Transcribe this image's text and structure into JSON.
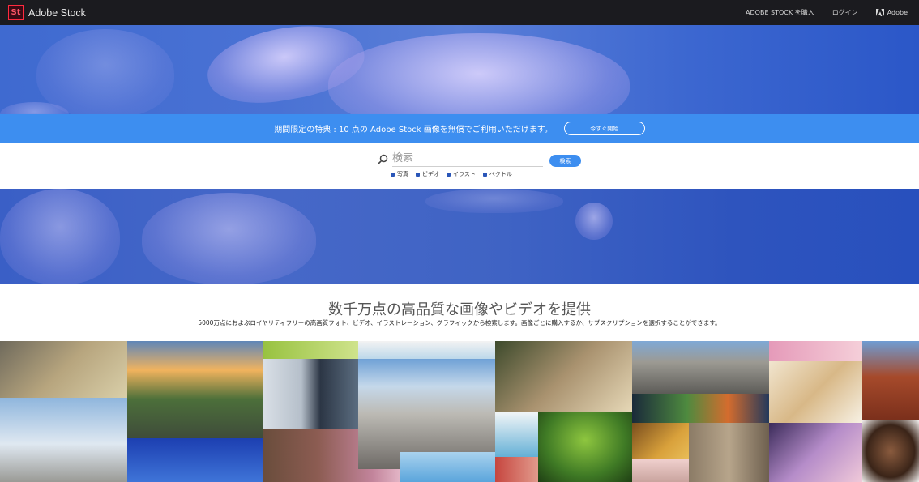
{
  "nav": {
    "logo": "St",
    "brand": "Adobe Stock",
    "buy": "ADOBE STOCK を購入",
    "login": "ログイン",
    "adobe": "Adobe"
  },
  "promo": {
    "text": "期間限定の特典 : 10 点の Adobe Stock 画像を無償でご利用いただけます。",
    "button": "今すぐ開始"
  },
  "search": {
    "placeholder": "検索",
    "button": "検索",
    "filters": [
      "写真",
      "ビデオ",
      "イラスト",
      "ベクトル"
    ]
  },
  "tagline": {
    "headline": "数千万点の高品質な画像やビデオを提供",
    "subline": "5000万点におよぶロイヤリティフリーの高画質フォト、ビデオ、イラストレーション、グラフィックから検索します。画像ごとに購入するか、サブスクリプションを選択することができます。"
  },
  "colors": {
    "topnav": "#1b1b1f",
    "promo": "#3d8ef0",
    "accent": "#3d8ef0"
  }
}
